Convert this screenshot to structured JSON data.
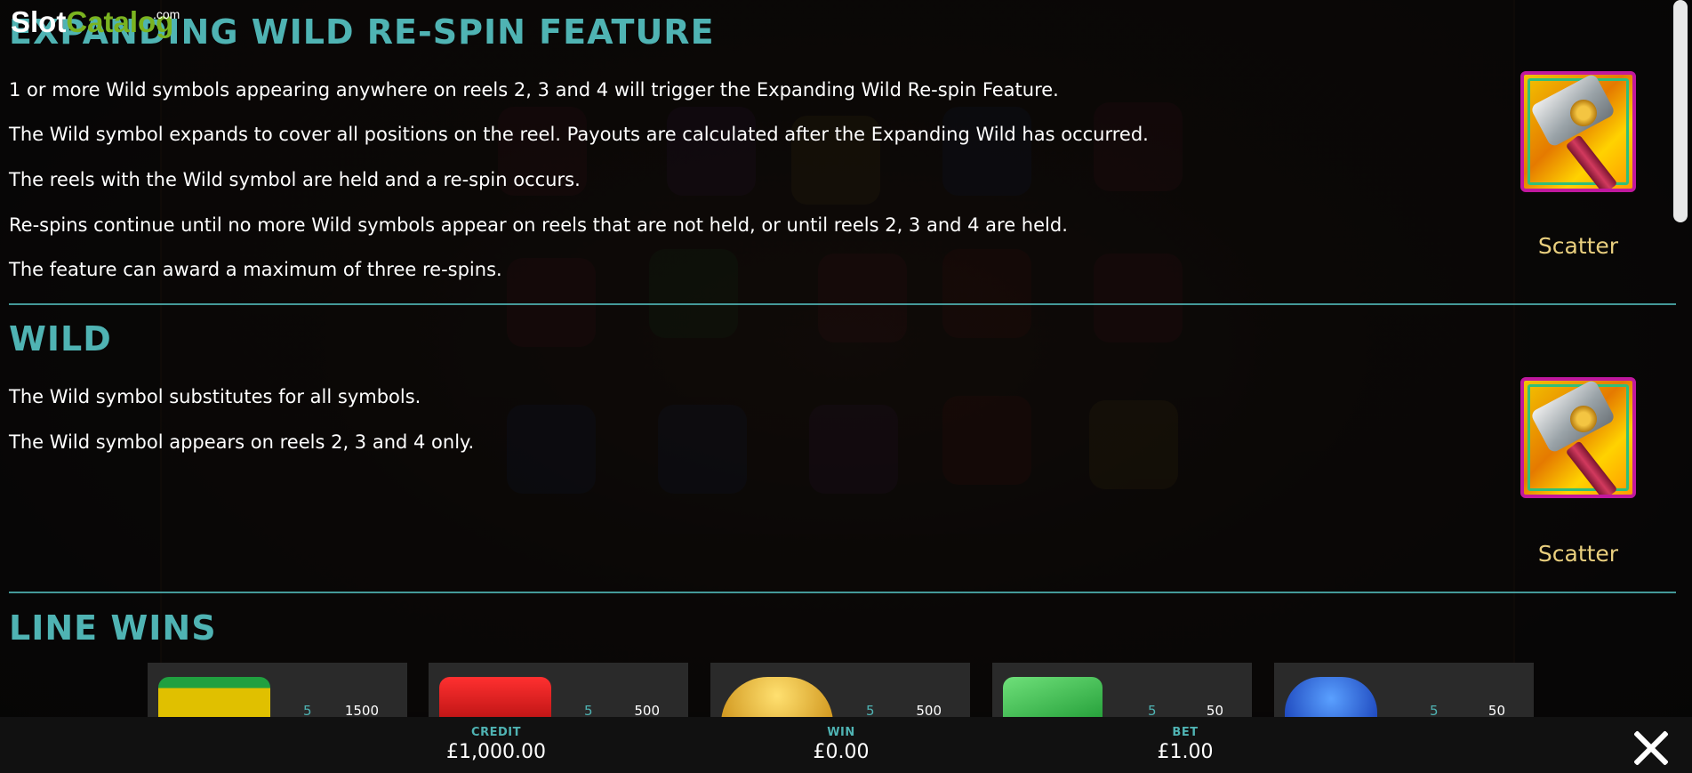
{
  "watermark": {
    "slot": "Slot",
    "catalog": "Catalog",
    "com": ".com"
  },
  "expanding": {
    "title": "EXPANDING WILD RE-SPIN FEATURE",
    "lines": [
      "1 or more Wild symbols appearing anywhere on reels 2, 3 and 4 will trigger the Expanding Wild Re-spin Feature.",
      "The Wild symbol expands to cover all positions on the reel. Payouts are calculated after the Expanding Wild has occurred.",
      "The reels with the Wild symbol are held and a re-spin occurs.",
      "Re-spins continue until no more Wild symbols appear on reels that are not held, or until reels 2, 3 and 4 are held.",
      "The feature can award a maximum of three re-spins."
    ],
    "symbol_label": "Scatter",
    "symbol_icon": "hammer-icon"
  },
  "wild": {
    "title": "WILD",
    "lines": [
      "The Wild symbol substitutes for all symbols.",
      "The Wild symbol appears on reels 2, 3 and 4 only."
    ],
    "symbol_label": "Scatter",
    "symbol_icon": "hammer-icon"
  },
  "line_wins": {
    "title": "LINE WINS",
    "items": [
      {
        "icon": "bar-icon",
        "count": "5",
        "payout": "1500",
        "color": "#e0c000"
      },
      {
        "icon": "seven-icon",
        "count": "5",
        "payout": "500",
        "color": "#d01818"
      },
      {
        "icon": "yellow-gem-icon",
        "count": "5",
        "payout": "500",
        "color": "#e0a820"
      },
      {
        "icon": "green-gem-icon",
        "count": "5",
        "payout": "50",
        "color": "#1fae3a"
      },
      {
        "icon": "blue-gem-icon",
        "count": "5",
        "payout": "50",
        "color": "#1f5fe0"
      }
    ]
  },
  "footer": {
    "credit_label": "CREDIT",
    "credit_value": "£1,000.00",
    "win_label": "WIN",
    "win_value": "£0.00",
    "bet_label": "BET",
    "bet_value": "£1.00"
  },
  "colors": {
    "accent": "#4fb3b3",
    "label_gold": "#e9cf7e"
  }
}
